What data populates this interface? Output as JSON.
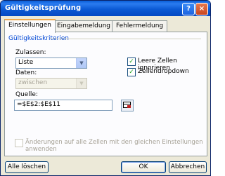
{
  "window": {
    "title": "Gültigkeitsprüfung",
    "help_label": "?",
    "close_label": "×"
  },
  "tabs": [
    {
      "label": "Einstellungen",
      "active": true
    },
    {
      "label": "Eingabemeldung",
      "active": false
    },
    {
      "label": "Fehlermeldung",
      "active": false
    }
  ],
  "criteria": {
    "group_title": "Gültigkeitskriterien",
    "allow_label": "Zulassen:",
    "allow_value": "Liste",
    "data_label": "Daten:",
    "data_value": "zwischen",
    "source_label": "Quelle:",
    "source_value": "=$E$2:$E$11",
    "ignore_blank_label": "Leere Zellen ignorieren",
    "ignore_blank_checked": true,
    "in_cell_dropdown_label": "Zellendropdown",
    "in_cell_dropdown_checked": true,
    "apply_all_label": "Änderungen auf alle Zellen mit den gleichen Einstellungen anwenden",
    "apply_all_checked": false
  },
  "buttons": {
    "clear_all": "Alle löschen",
    "ok": "OK",
    "cancel": "Abbrechen"
  },
  "colors": {
    "titlebar": "#0a5fd8",
    "group_title": "#0046d5",
    "check": "#21a121",
    "tab_highlight": "#f1a84a"
  }
}
